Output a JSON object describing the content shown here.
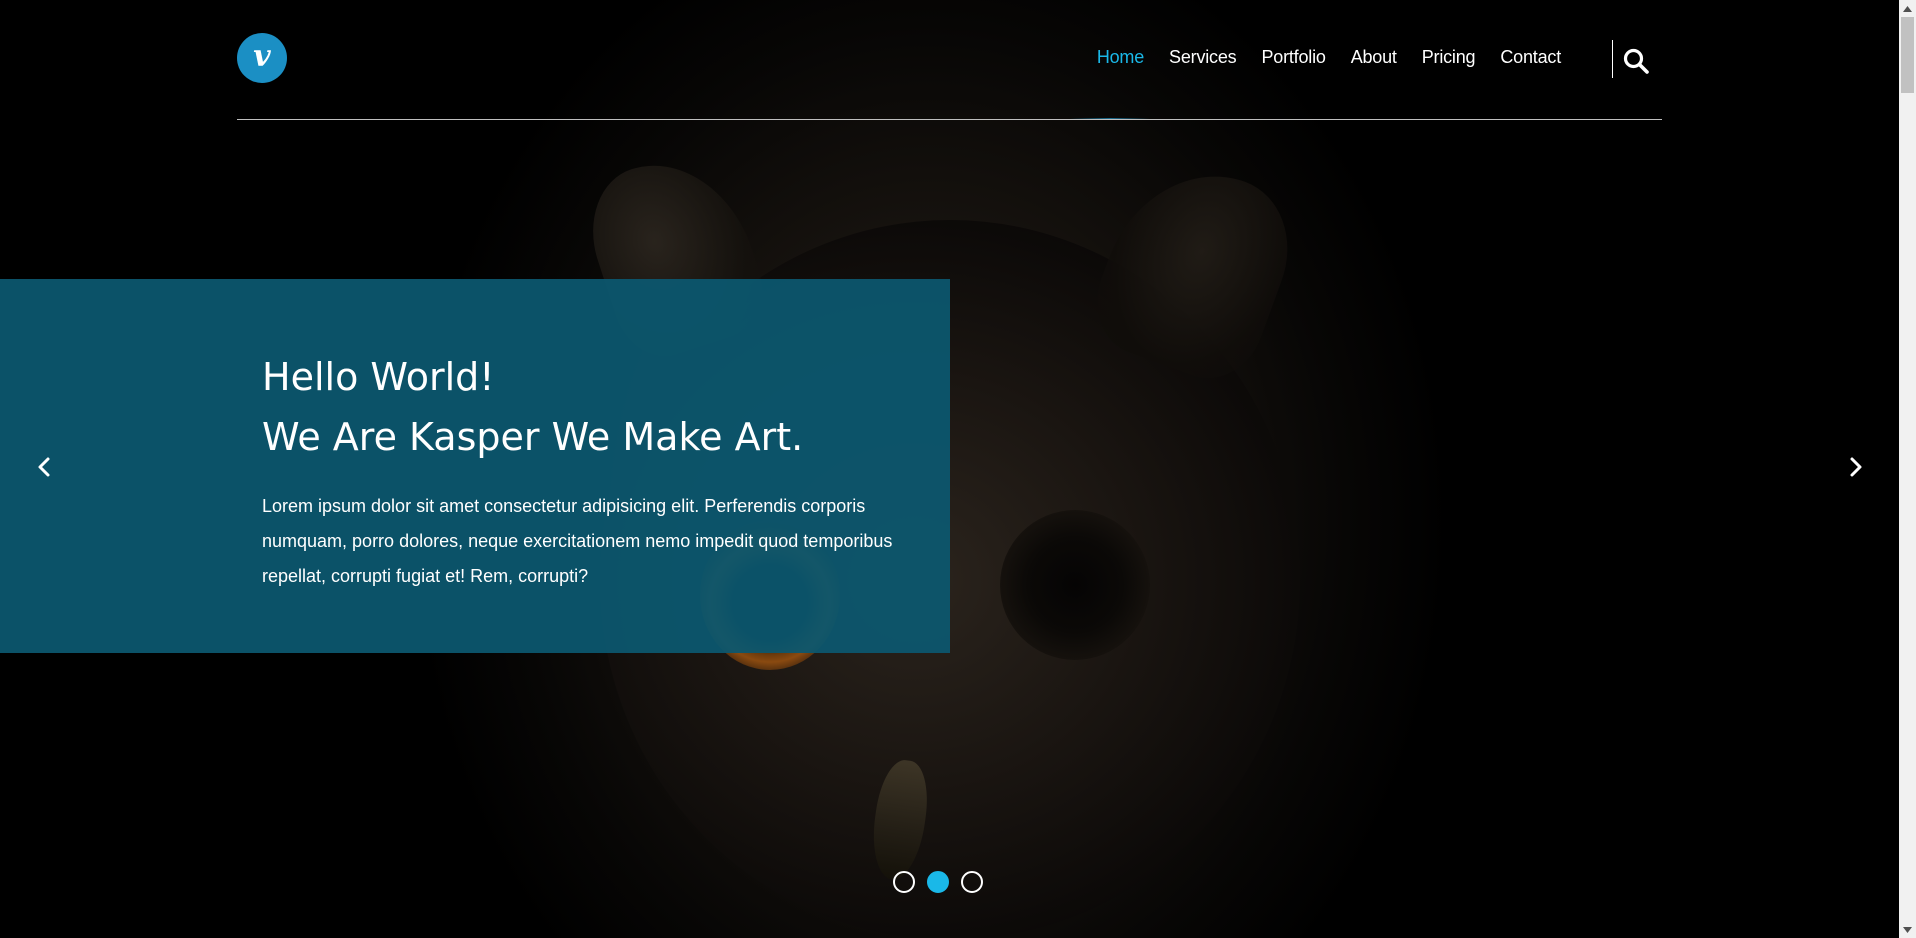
{
  "brand": {
    "logo_letter": "v",
    "accent": "#1ab8e8",
    "logo_color": "#1b8fc4"
  },
  "nav": {
    "items": [
      {
        "label": "Home",
        "active": true
      },
      {
        "label": "Services",
        "active": false
      },
      {
        "label": "Portfolio",
        "active": false
      },
      {
        "label": "About",
        "active": false
      },
      {
        "label": "Pricing",
        "active": false
      },
      {
        "label": "Contact",
        "active": false
      }
    ],
    "search_icon": "search-icon"
  },
  "hero": {
    "title_line1": "Hello World!",
    "title_line2": "We Are Kasper We Make Art.",
    "text": "Lorem ipsum dolor sit amet consectetur adipisicing elit. Perferendis corporis numquam, porro dolores, neque exercitationem nemo impedit quod temporibus repellat, corrupti fugiat et! Rem, corrupti?",
    "box_color": "#0c576f"
  },
  "slider": {
    "prev_icon": "chevron-left-icon",
    "next_icon": "chevron-right-icon",
    "dots_count": 3,
    "active_dot": 2
  }
}
